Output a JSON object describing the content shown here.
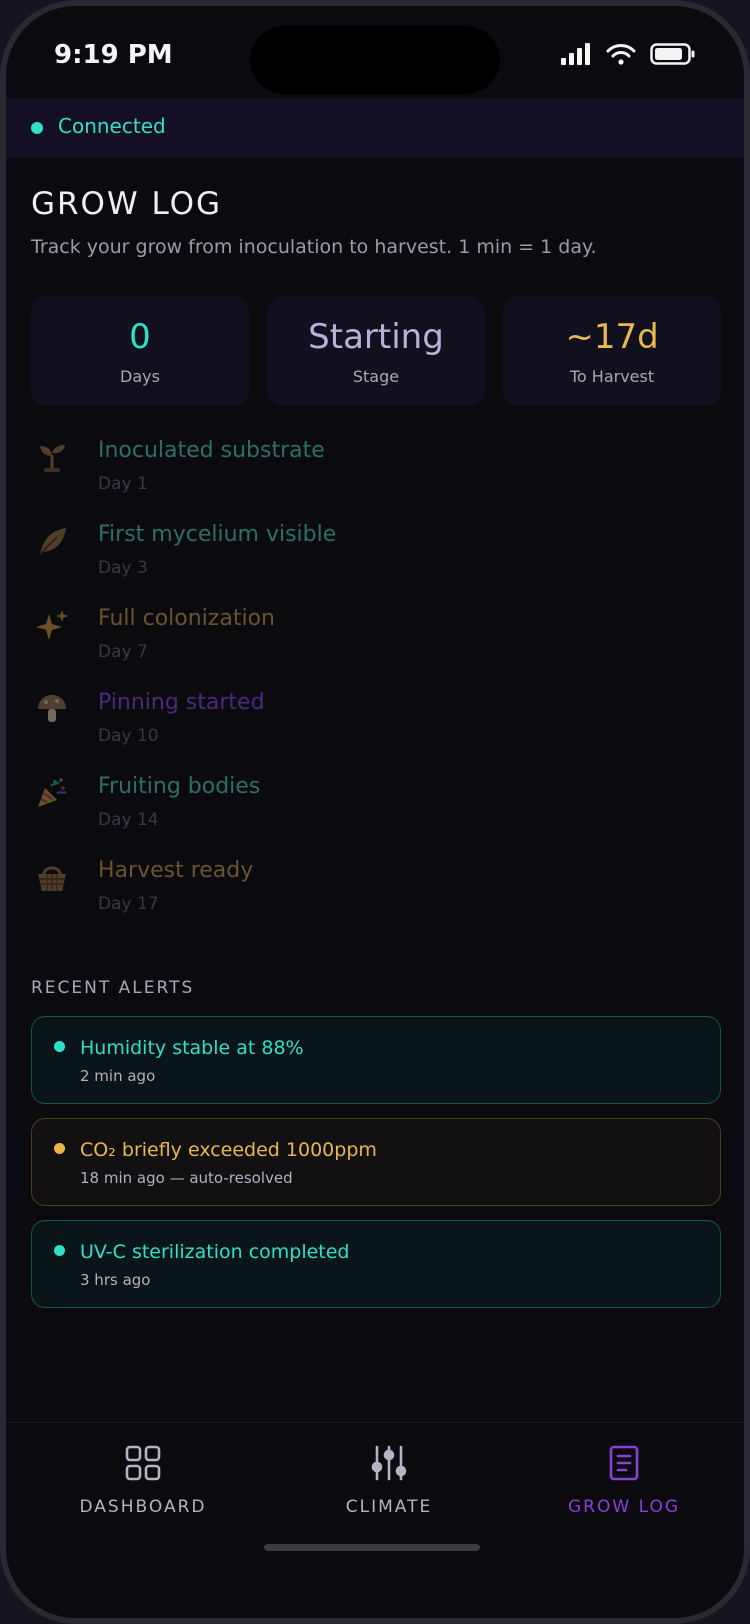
{
  "status_bar": {
    "time": "9:19 PM"
  },
  "connection": {
    "label": "Connected",
    "color": "#2fe0c8"
  },
  "page": {
    "title": "GROW LOG",
    "subtitle": "Track your grow from inoculation to harvest. 1 min = 1 day."
  },
  "stats": [
    {
      "value": "0",
      "label": "Days",
      "color": "#2fe0c8"
    },
    {
      "value": "Starting",
      "label": "Stage",
      "color": "#b9b1d6"
    },
    {
      "value": "~17d",
      "label": "To Harvest",
      "color": "#e6b84e"
    }
  ],
  "milestones": [
    {
      "title": "Inoculated substrate",
      "day": "Day 1",
      "icon": "sprout-icon",
      "color": "#2f6e67"
    },
    {
      "title": "First mycelium visible",
      "day": "Day 3",
      "icon": "leaf-icon",
      "color": "#2f6e67"
    },
    {
      "title": "Full colonization",
      "day": "Day 7",
      "icon": "sparkles-icon",
      "color": "#6b5330"
    },
    {
      "title": "Pinning started",
      "day": "Day 10",
      "icon": "mushroom-icon",
      "color": "#4a2a7a"
    },
    {
      "title": "Fruiting bodies",
      "day": "Day 14",
      "icon": "party-popper-icon",
      "color": "#2f6e67"
    },
    {
      "title": "Harvest ready",
      "day": "Day 17",
      "icon": "basket-icon",
      "color": "#6b5330"
    }
  ],
  "alerts": {
    "heading": "RECENT ALERTS",
    "items": [
      {
        "text": "Humidity stable at 88%",
        "time": "2 min ago",
        "color": "#2fe0c8",
        "border": "#11574f",
        "bg": "#0a1519"
      },
      {
        "text": "CO₂ briefly exceeded 1000ppm",
        "time": "18 min ago — auto-resolved",
        "color": "#e6b84e",
        "border": "#4e3f1c",
        "bg": "#121010"
      },
      {
        "text": "UV-C sterilization completed",
        "time": "3 hrs ago",
        "color": "#2fe0c8",
        "border": "#11574f",
        "bg": "#0a1519"
      }
    ]
  },
  "nav": [
    {
      "label": "DASHBOARD",
      "icon": "grid-icon",
      "color": "#b6b3c4",
      "active": false
    },
    {
      "label": "CLIMATE",
      "icon": "sliders-icon",
      "color": "#b6b3c4",
      "active": false
    },
    {
      "label": "GROW LOG",
      "icon": "log-icon",
      "color": "#8a3fd6",
      "active": true
    }
  ]
}
